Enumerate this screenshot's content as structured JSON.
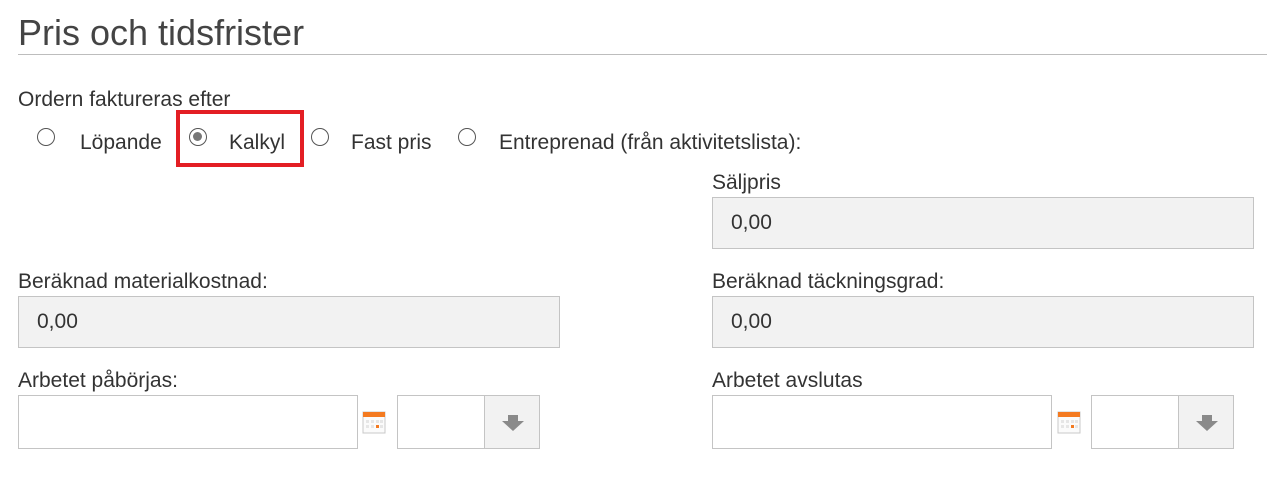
{
  "section": {
    "title": "Pris och tidsfrister"
  },
  "billing": {
    "label": "Ordern faktureras efter",
    "options": [
      {
        "label": "Löpande",
        "selected": false
      },
      {
        "label": "Kalkyl",
        "selected": true
      },
      {
        "label": "Fast pris",
        "selected": false
      },
      {
        "label": "Entreprenad (från aktivitetslista):",
        "selected": false
      }
    ]
  },
  "saljpris": {
    "label": "Säljpris",
    "value": "0,00"
  },
  "materialkostnad": {
    "label": "Beräknad materialkostnad:",
    "value": "0,00"
  },
  "tackningsgrad": {
    "label": "Beräknad täckningsgrad:",
    "value": "0,00"
  },
  "start": {
    "label": "Arbetet påbörjas:",
    "date": "",
    "time": ""
  },
  "end": {
    "label": "Arbetet avslutas",
    "date": "",
    "time": ""
  },
  "colors": {
    "highlight": "#e31e24",
    "calendar_accent": "#f47a20"
  },
  "icons": {
    "calendar": "calendar-icon",
    "dropdown": "chevron-down-icon"
  }
}
